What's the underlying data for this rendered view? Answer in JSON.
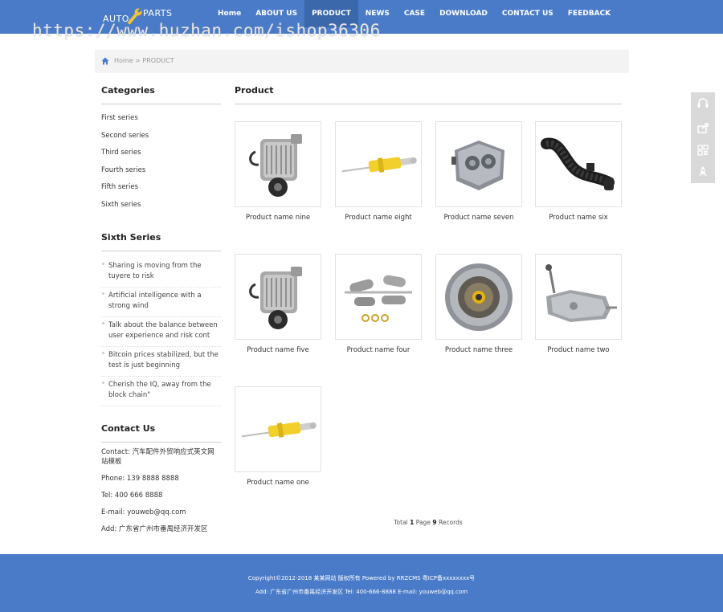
{
  "logo": {
    "auto": "AUTO",
    "parts": "PARTS"
  },
  "nav": [
    {
      "label": "Home"
    },
    {
      "label": "ABOUT US"
    },
    {
      "label": "PRODUCT"
    },
    {
      "label": "NEWS"
    },
    {
      "label": "CASE"
    },
    {
      "label": "DOWNLOAD"
    },
    {
      "label": "CONTACT US"
    },
    {
      "label": "FEEDBACK"
    }
  ],
  "watermark": "https://www.huzhan.com/ishop36306",
  "breadcrumb": {
    "home": "Home",
    "separator": ">",
    "current": "PRODUCT"
  },
  "sidebar": {
    "categories_title": "Categories",
    "categories": [
      "First series",
      "Second series",
      "Third series",
      "Fourth series",
      "Fifth series",
      "Sixth series"
    ],
    "news_title": "Sixth Series",
    "news": [
      "Sharing is moving from the tuyere to risk",
      "Artificial intelligence with a strong wind",
      "Talk about the balance between user experience and risk cont",
      "Bitcoin prices stabilized, but the test is just beginning",
      "Cherish the IQ, away from the block chain\""
    ],
    "contact_title": "Contact Us",
    "contact": [
      "Contact: 汽车配件外贸响应式英文网站模板",
      "Phone: 139 8888 8888",
      "Tel: 400 666 8888",
      "E-mail: youweb@qq.com",
      "Add: 广东省广州市番禺经济开发区"
    ]
  },
  "main": {
    "title": "Product",
    "products": [
      {
        "name": "Product name nine",
        "image": "supercharger"
      },
      {
        "name": "Product name eight",
        "image": "shock-absorber"
      },
      {
        "name": "Product name seven",
        "image": "engine-block"
      },
      {
        "name": "Product name six",
        "image": "intake-hose"
      },
      {
        "name": "Product name five",
        "image": "supercharger"
      },
      {
        "name": "Product name four",
        "image": "exhaust-parts"
      },
      {
        "name": "Product name three",
        "image": "clutch"
      },
      {
        "name": "Product name two",
        "image": "gearbox"
      },
      {
        "name": "Product name one",
        "image": "shock-absorber"
      }
    ],
    "pager": {
      "total_label": "Total",
      "pages": "1",
      "page_label": "Page",
      "records": "9",
      "records_label": "Records"
    }
  },
  "float_bar": [
    "headset-icon",
    "share-icon",
    "qrcode-icon",
    "rocket-icon"
  ],
  "footer": {
    "line1": "Copyright©2012-2018 某某网站 版权所有 Powered by RRZCMS 粤ICP备xxxxxxxx号",
    "line2": "Add: 广东省广州市番禺经济开发区  Tel: 400-666-8888  E-mail: youweb@qq.com"
  },
  "colors": {
    "brand": "#4a7bc8",
    "nav_active": "#3b67ab",
    "float_bar": "#d9d9d9"
  }
}
